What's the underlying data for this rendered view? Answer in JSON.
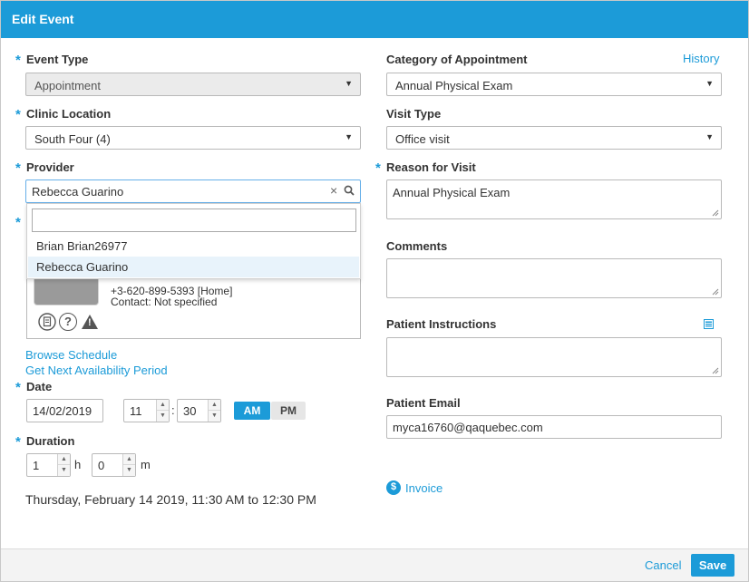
{
  "dialog": {
    "title": "Edit Event"
  },
  "event_type": {
    "label": "Event Type",
    "value": "Appointment"
  },
  "clinic_location": {
    "label": "Clinic Location",
    "value": "South Four (4)"
  },
  "provider": {
    "label": "Provider",
    "value": "Rebecca Guarino",
    "search_value": "",
    "options": [
      "Brian Brian26977",
      "Rebecca Guarino"
    ],
    "selected_index": 1
  },
  "patient": {
    "phone": "+3-620-899-5393 [Home]",
    "contact": "Contact: Not specified"
  },
  "links": {
    "browse_schedule": "Browse Schedule",
    "next_availability": "Get Next Availability Period",
    "history": "History",
    "invoice": "Invoice"
  },
  "date": {
    "label": "Date",
    "value": "14/02/2019"
  },
  "time": {
    "hour": "11",
    "separator": ":",
    "minute": "30",
    "am_label": "AM",
    "pm_label": "PM",
    "meridiem": "AM"
  },
  "duration": {
    "label": "Duration",
    "hours": "1",
    "hours_unit": "h",
    "minutes": "0",
    "minutes_unit": "m"
  },
  "summary": "Thursday, February 14 2019, 11:30 AM to 12:30 PM",
  "category": {
    "label": "Category of Appointment",
    "value": "Annual Physical Exam"
  },
  "visit_type": {
    "label": "Visit Type",
    "value": "Office visit"
  },
  "reason": {
    "label": "Reason for Visit",
    "value": "Annual Physical Exam"
  },
  "comments": {
    "label": "Comments",
    "value": ""
  },
  "patient_instructions": {
    "label": "Patient Instructions",
    "value": ""
  },
  "patient_email": {
    "label": "Patient Email",
    "value": "myca16760@qaquebec.com"
  },
  "footer": {
    "cancel_label": "Cancel",
    "save_label": "Save"
  },
  "required_marker": "*",
  "icons": {
    "select_caret": "▼",
    "spin_up": "▲",
    "spin_down": "▼",
    "clear": "×",
    "invoice": "$",
    "help": "?",
    "warning": "!"
  },
  "colors": {
    "accent": "#1c9bd8",
    "header": "#1c9bd8",
    "selected_row": "#e8f3fb"
  }
}
